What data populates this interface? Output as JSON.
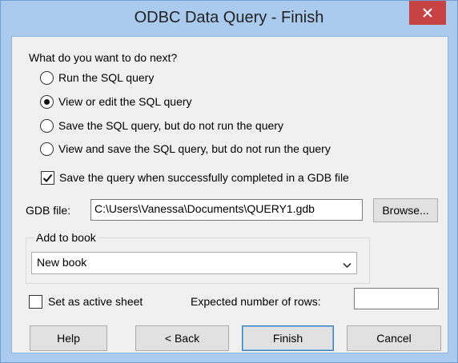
{
  "window": {
    "title": "ODBC Data Query - Finish"
  },
  "prompt": "What do you want to do next?",
  "options": [
    {
      "label": "Run the SQL query",
      "checked": false
    },
    {
      "label": "View or edit the SQL query",
      "checked": true
    },
    {
      "label": "Save the SQL query, but do not run the query",
      "checked": false
    },
    {
      "label": "View and save the SQL query, but do not run the query",
      "checked": false
    }
  ],
  "save_gdb": {
    "label": "Save the query when successfully completed in a GDB file",
    "checked": true
  },
  "gdb": {
    "label": "GDB file:",
    "value": "C:\\Users\\Vanessa\\Documents\\QUERY1.gdb",
    "browse_label": "Browse..."
  },
  "book": {
    "group_label": "Add to book",
    "selected": "New book"
  },
  "active_sheet": {
    "label": "Set as active sheet",
    "checked": false
  },
  "rows": {
    "label": "Expected number of rows:",
    "value": ""
  },
  "buttons": {
    "help": "Help",
    "back": "< Back",
    "finish": "Finish",
    "cancel": "Cancel"
  }
}
